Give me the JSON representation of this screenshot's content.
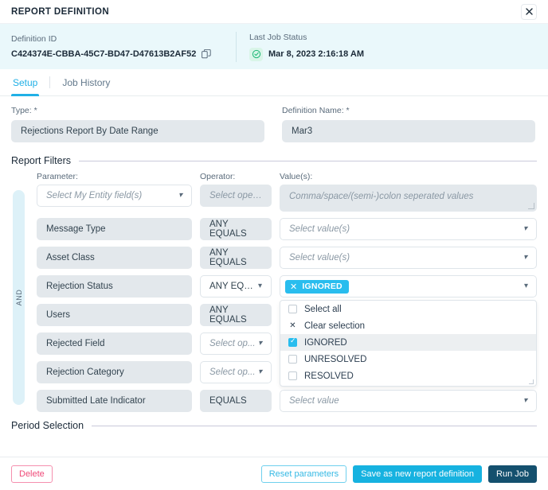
{
  "window": {
    "title": "REPORT DEFINITION",
    "close_label": "✕"
  },
  "info": {
    "definition_id_label": "Definition ID",
    "definition_id_value": "C424374E-CBBA-45C7-BD47-D47613B2AF52",
    "last_job_status_label": "Last Job Status",
    "last_job_status_value": "Mar 8, 2023 2:16:18 AM",
    "status_color": "#1fb978",
    "band_color": "#eaf8fb"
  },
  "tabs": {
    "items": [
      {
        "label": "Setup",
        "active": true
      },
      {
        "label": "Job History",
        "active": false
      }
    ],
    "accent": "#21b0e6"
  },
  "form": {
    "type_label": "Type: *",
    "type_value": "Rejections Report By Date Range",
    "name_label": "Definition Name: *",
    "name_value": "Mar3"
  },
  "sections": {
    "report_filters": "Report Filters",
    "period_selection": "Period Selection"
  },
  "filters": {
    "group_operator": "AND",
    "headers": {
      "parameter": "Parameter:",
      "operator": "Operator:",
      "value": "Value(s):"
    },
    "new_row": {
      "parameter_placeholder": "Select My Entity field(s)",
      "operator_placeholder": "Select oper...",
      "value_placeholder": "Comma/space/(semi-)colon seperated values"
    },
    "rows": [
      {
        "parameter": "Message Type",
        "operator": "ANY EQUALS",
        "operator_disabled": true,
        "value_placeholder": "Select value(s)",
        "value_type": "select"
      },
      {
        "parameter": "Asset Class",
        "operator": "ANY EQUALS",
        "operator_disabled": true,
        "value_placeholder": "Select value(s)",
        "value_type": "select"
      },
      {
        "parameter": "Rejection Status",
        "operator": "ANY EQU...",
        "operator_disabled": false,
        "value_type": "tags",
        "selected_tags": [
          "IGNORED"
        ]
      },
      {
        "parameter": "Users",
        "operator": "ANY EQUALS",
        "operator_disabled": true,
        "value_placeholder": "",
        "value_type": "hidden"
      },
      {
        "parameter": "Rejected Field",
        "operator": "Select op...",
        "operator_disabled": false,
        "operator_placeholder": true,
        "value_placeholder": "",
        "value_type": "hidden"
      },
      {
        "parameter": "Rejection Category",
        "operator": "Select op...",
        "operator_disabled": false,
        "operator_placeholder": true,
        "value_placeholder": "",
        "value_type": "hidden"
      },
      {
        "parameter": "Submitted Late Indicator",
        "operator": "EQUALS",
        "operator_disabled": true,
        "value_placeholder": "Select value",
        "value_type": "select"
      }
    ],
    "dropdown": {
      "select_all": "Select all",
      "clear_selection": "Clear selection",
      "options": [
        {
          "label": "IGNORED",
          "checked": true,
          "highlighted": true
        },
        {
          "label": "UNRESOLVED",
          "checked": false,
          "highlighted": false
        },
        {
          "label": "RESOLVED",
          "checked": false,
          "highlighted": false
        }
      ]
    }
  },
  "footer": {
    "delete": "Delete",
    "reset": "Reset parameters",
    "save": "Save as new report definition",
    "run": "Run Job",
    "delete_color": "#ef4a78",
    "save_color": "#16b2e0",
    "run_color": "#14506e"
  }
}
